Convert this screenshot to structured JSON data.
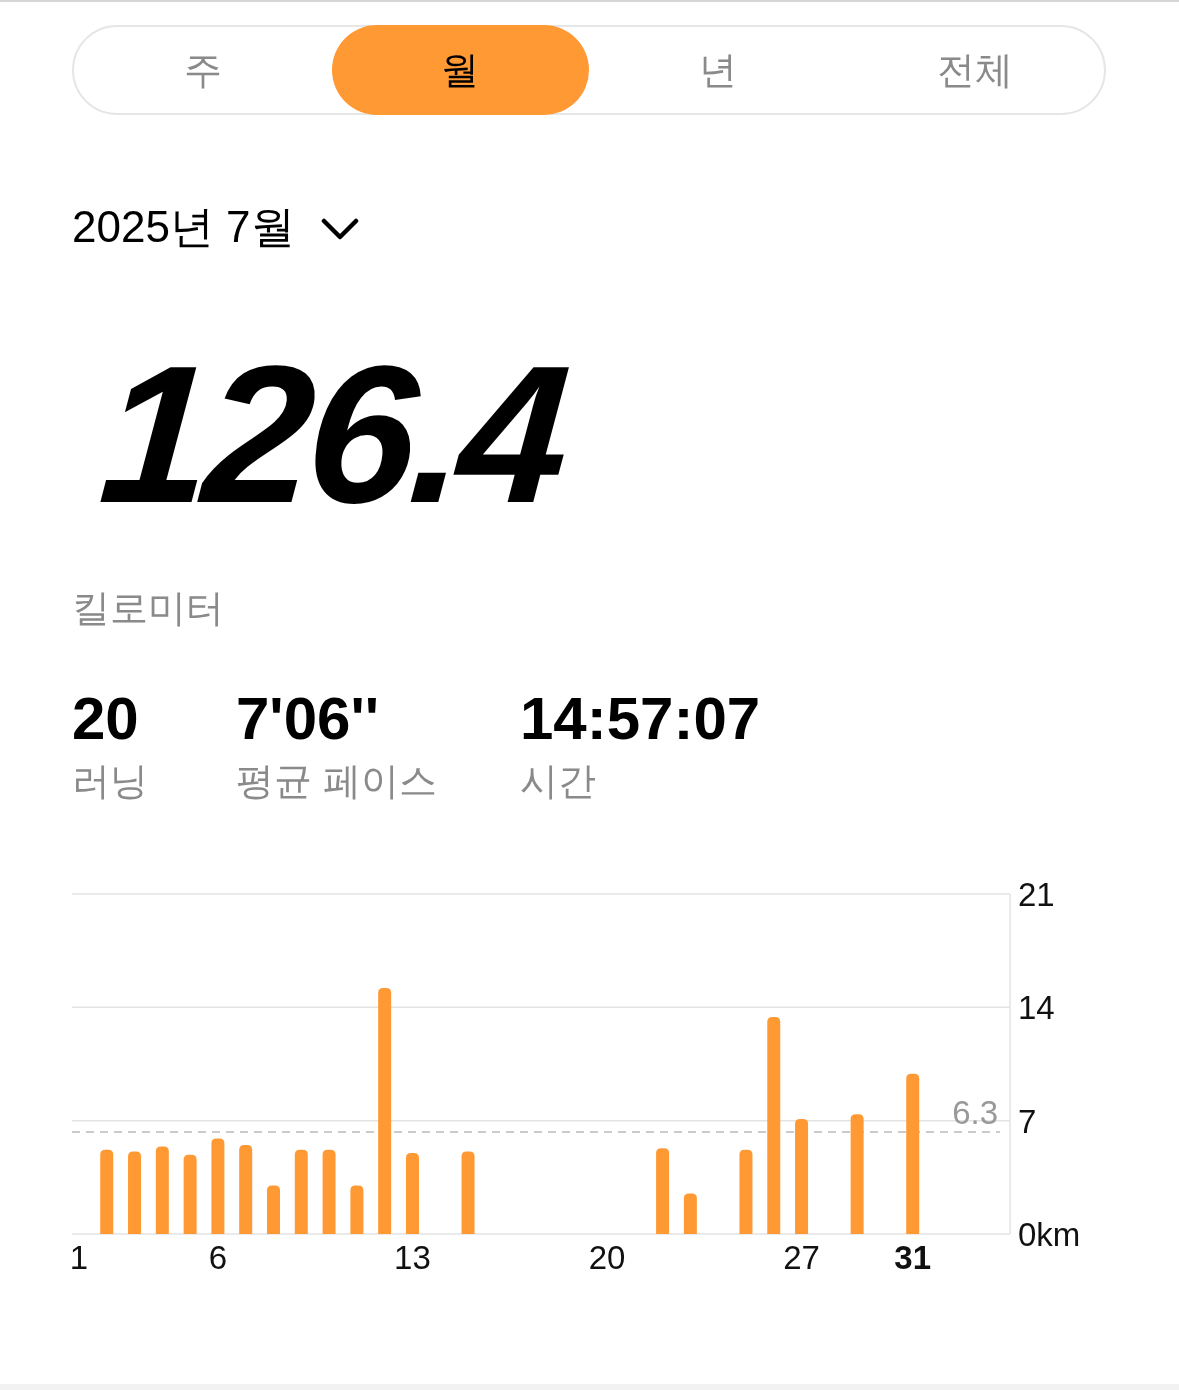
{
  "segments": [
    {
      "label": "주",
      "selected": false
    },
    {
      "label": "월",
      "selected": true
    },
    {
      "label": "년",
      "selected": false
    },
    {
      "label": "전체",
      "selected": false
    }
  ],
  "period": {
    "label": "2025년 7월"
  },
  "total": {
    "value": "126.4",
    "unit": "킬로미터"
  },
  "stats": [
    {
      "value": "20",
      "label": "러닝"
    },
    {
      "value": "7'06''",
      "label": "평균 페이스"
    },
    {
      "value": "14:57:07",
      "label": "시간"
    }
  ],
  "chart_data": {
    "type": "bar",
    "x": [
      2,
      3,
      4,
      5,
      6,
      7,
      8,
      9,
      10,
      11,
      12,
      13,
      15,
      22,
      23,
      25,
      26,
      27,
      29,
      31
    ],
    "xlim": [
      0.75,
      34.5
    ],
    "series": [
      {
        "color": "#ff9933",
        "values": [
          5.2,
          5.1,
          5.4,
          4.9,
          5.9,
          5.5,
          3.0,
          5.2,
          5.2,
          3.0,
          15.2,
          5.0,
          5.1,
          5.3,
          2.5,
          5.2,
          13.4,
          7.1,
          7.4,
          9.9
        ]
      }
    ],
    "ylim": [
      0,
      21
    ],
    "yticks": [
      {
        "value": 0,
        "label": "0km"
      },
      {
        "value": 7,
        "label": "7"
      },
      {
        "value": 14,
        "label": "14"
      },
      {
        "value": 21,
        "label": "21"
      }
    ],
    "xticks": [
      {
        "value": 1,
        "label": "1"
      },
      {
        "value": 6,
        "label": "6"
      },
      {
        "value": 13,
        "label": "13"
      },
      {
        "value": 20,
        "label": "20"
      },
      {
        "value": 27,
        "label": "27"
      },
      {
        "value": 31,
        "label": "**31**"
      }
    ],
    "ref_lines": [
      {
        "axis": "y",
        "value": 6.3,
        "label": "6.3"
      }
    ]
  }
}
